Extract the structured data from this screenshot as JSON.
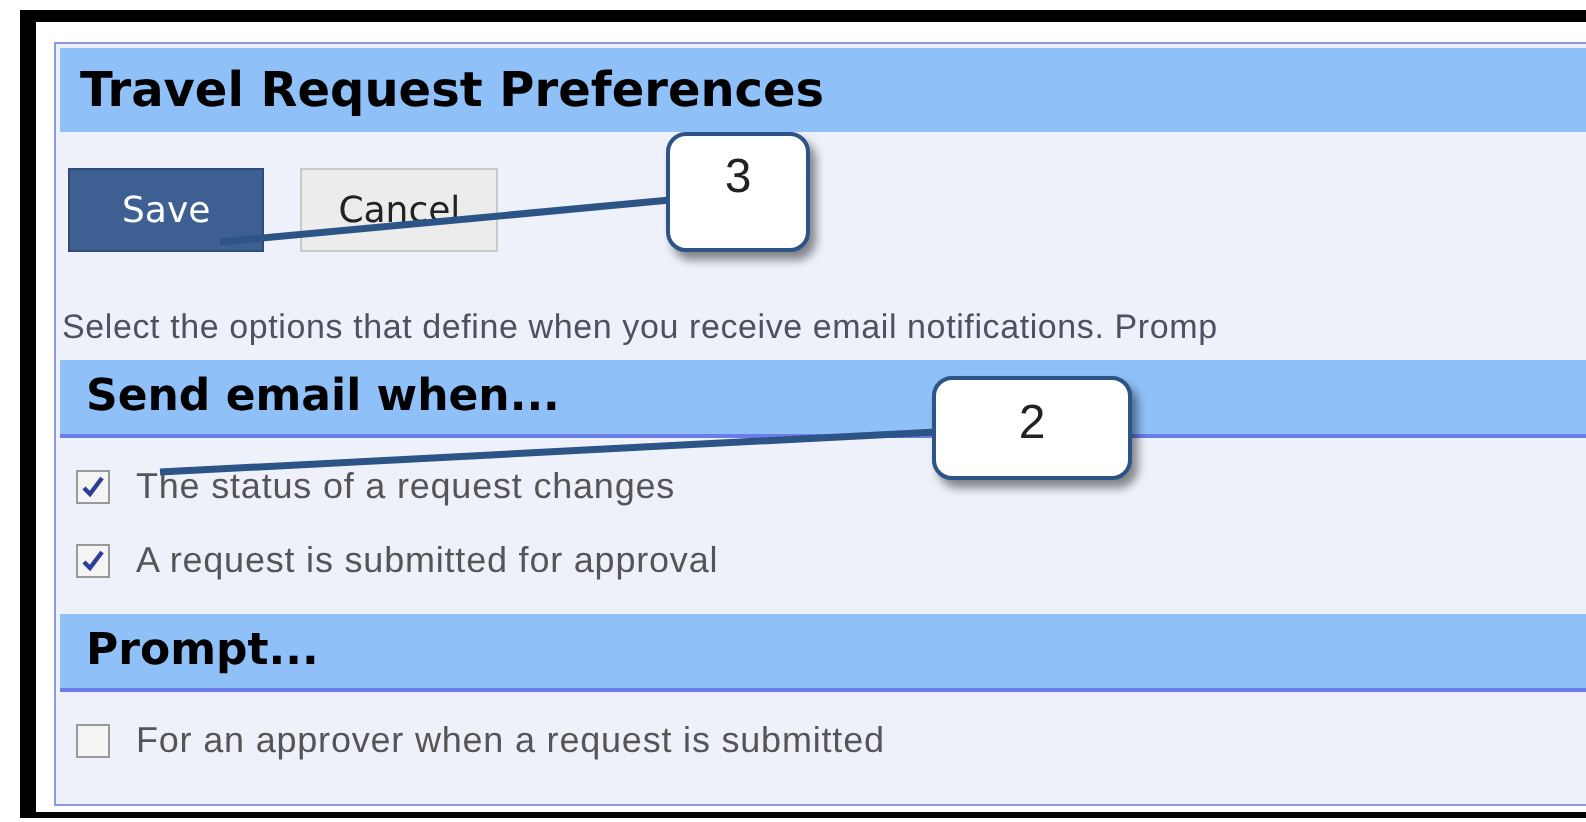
{
  "title": "Travel Request Preferences",
  "buttons": [
    {
      "label": "Save",
      "kind": "primary"
    },
    {
      "label": "Cancel",
      "kind": "secondary"
    }
  ],
  "description": "Select the options that define when you receive email notifications. Promp",
  "sections": [
    {
      "heading": "Send email when...",
      "options": [
        {
          "label": "The status of a request changes",
          "checked": true
        },
        {
          "label": "A request is submitted for approval",
          "checked": true
        }
      ]
    },
    {
      "heading": "Prompt...",
      "options": [
        {
          "label": "For an approver when a request is submitted",
          "checked": false
        }
      ]
    }
  ],
  "callouts": [
    {
      "label": "3"
    },
    {
      "label": "2"
    }
  ]
}
